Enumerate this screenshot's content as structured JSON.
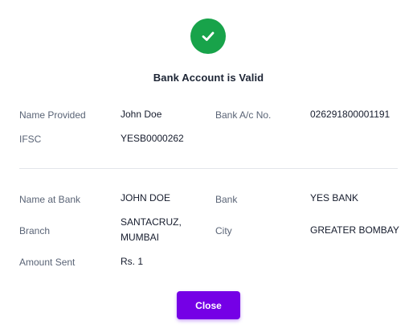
{
  "colors": {
    "success": "#18a34a",
    "primary": "#7500e6",
    "title": "#1c2434"
  },
  "header": {
    "icon": "checkmark-icon",
    "title": "Bank Account is Valid"
  },
  "details": {
    "name_provided_label": "Name Provided",
    "name_provided_value": "John Doe",
    "account_no_label": "Bank A/c No.",
    "account_no_value": "026291800001191",
    "ifsc_label": "IFSC",
    "ifsc_value": "YESB0000262"
  },
  "bank_info": {
    "name_at_bank_label": "Name at Bank",
    "name_at_bank_value": "JOHN DOE",
    "bank_label": "Bank",
    "bank_value": "YES BANK",
    "branch_label": "Branch",
    "branch_value_line1": "SANTACRUZ,",
    "branch_value_line2": "MUMBAI",
    "city_label": "City",
    "city_value": "GREATER BOMBAY",
    "amount_sent_label": "Amount Sent",
    "amount_sent_value": "Rs. 1"
  },
  "actions": {
    "close_label": "Close"
  }
}
